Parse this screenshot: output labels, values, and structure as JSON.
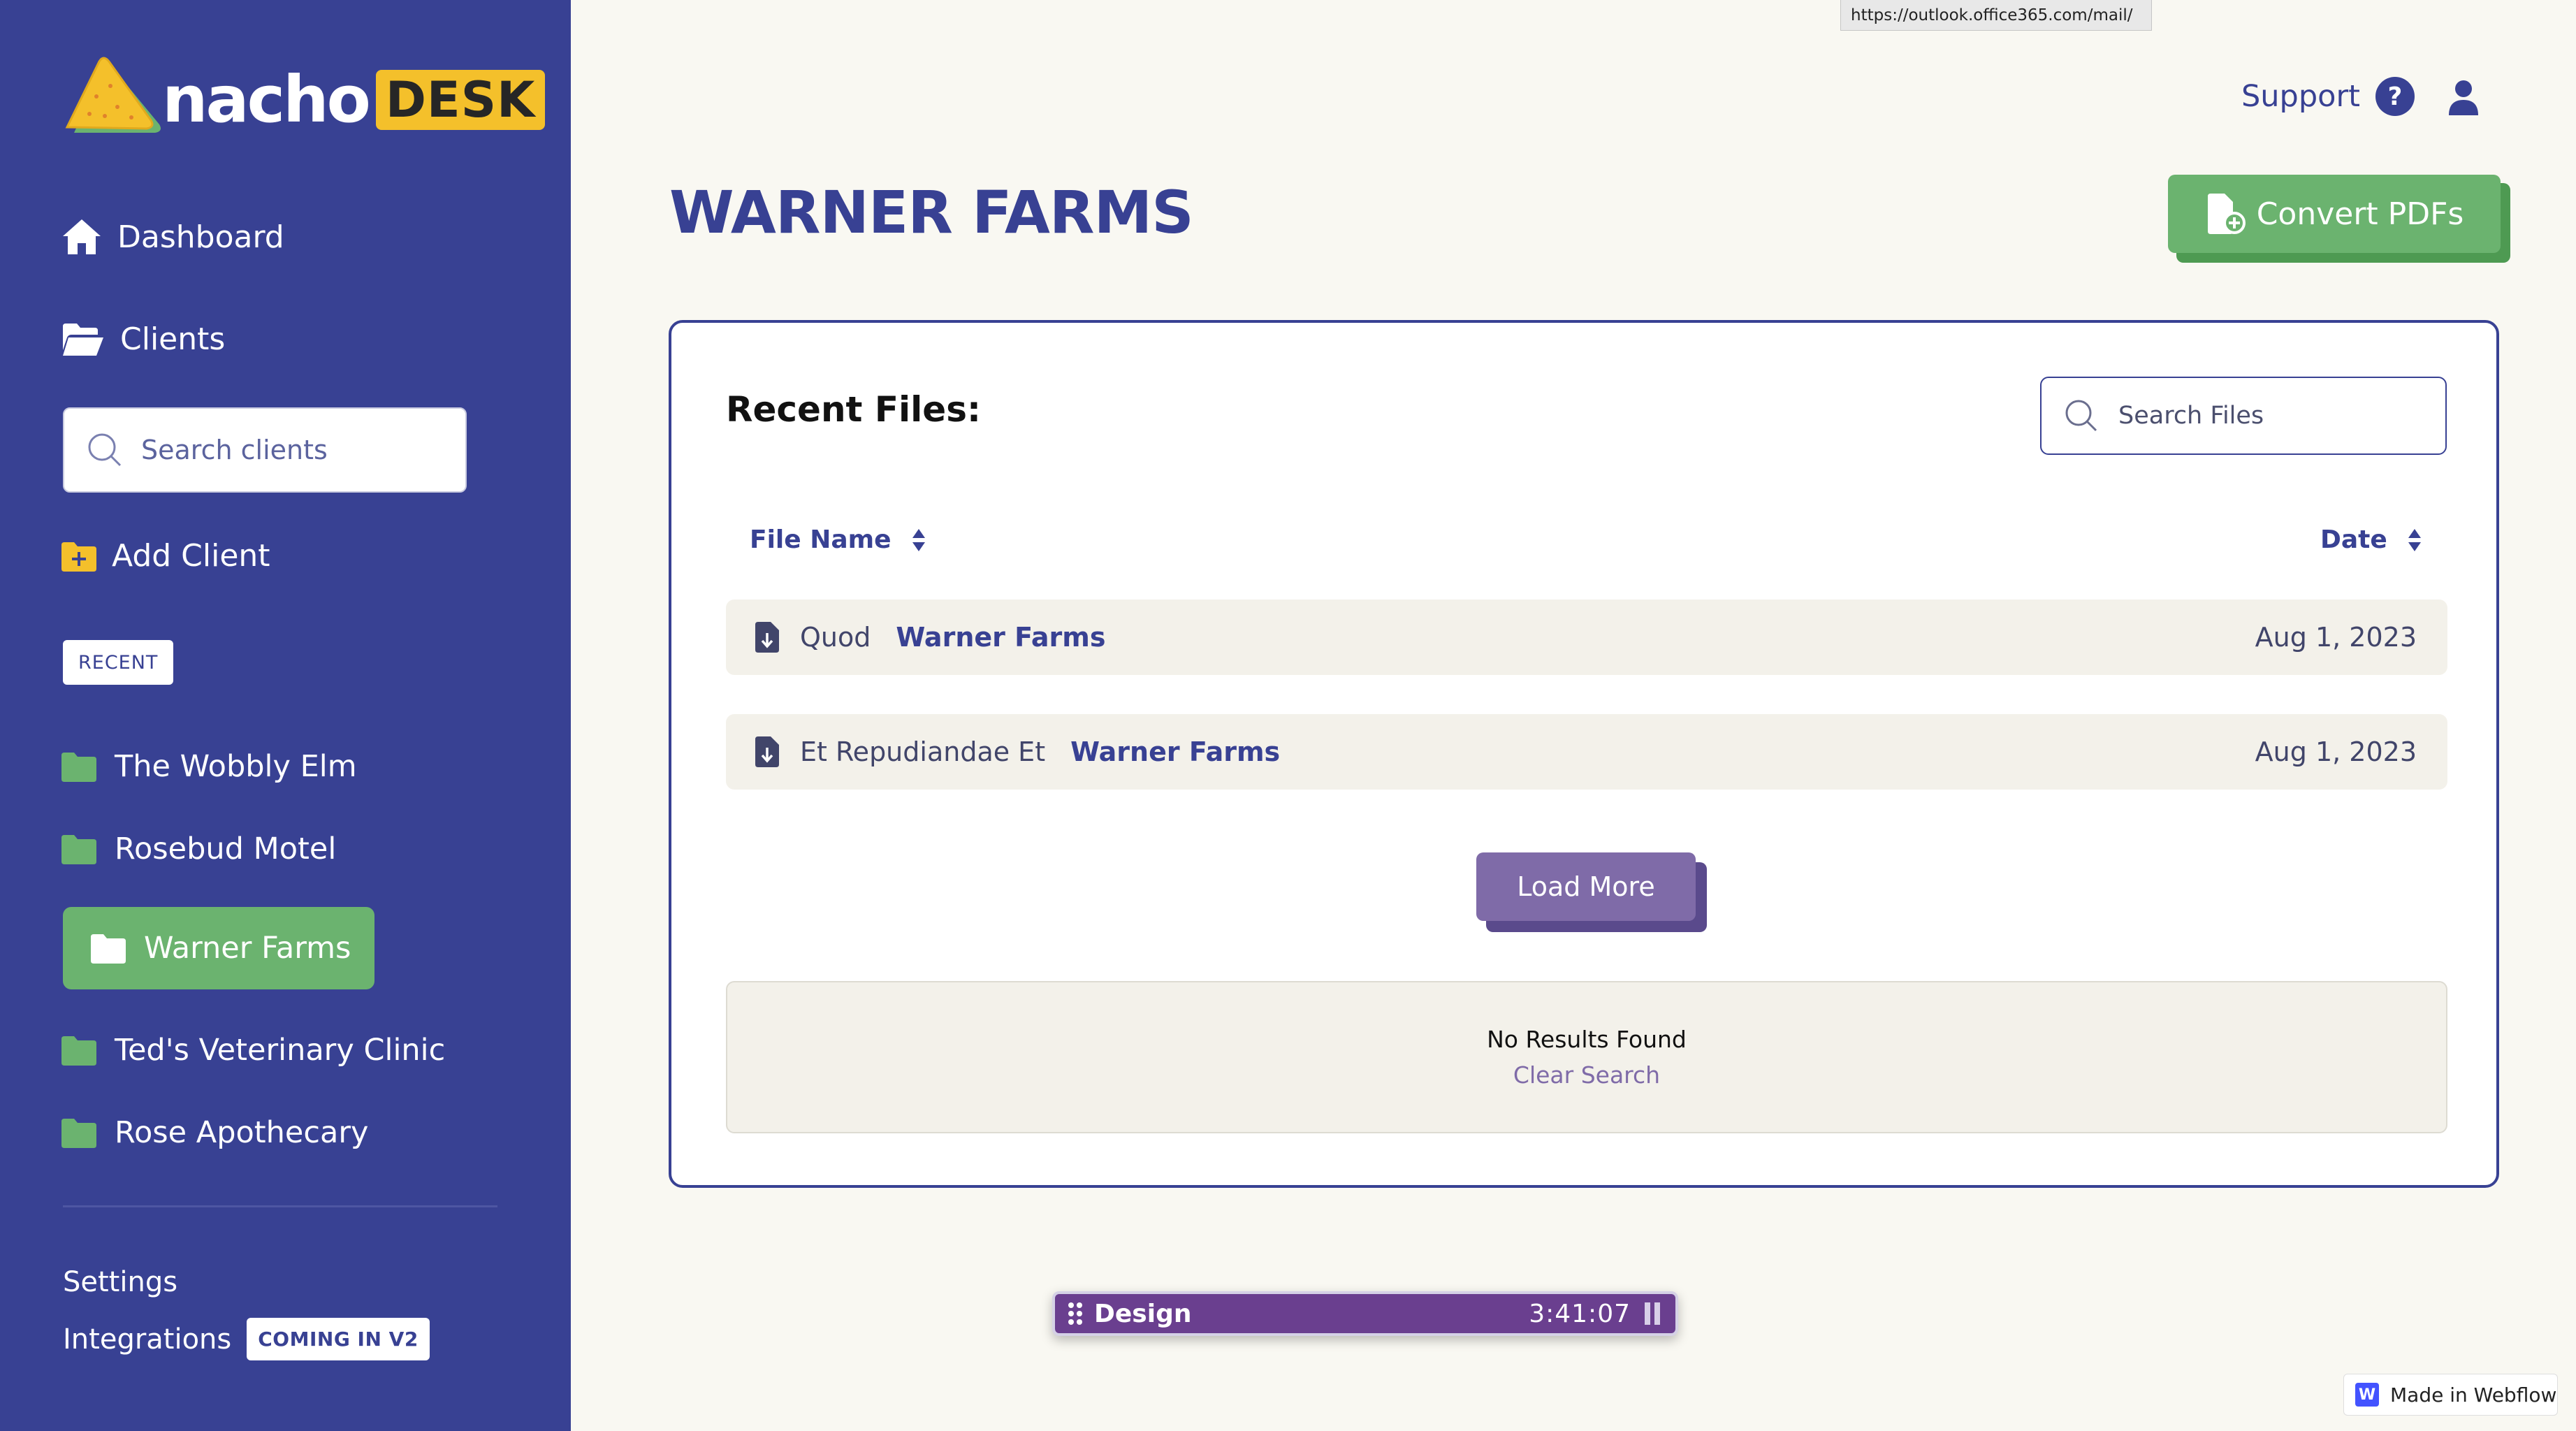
{
  "brand": {
    "word": "nacho",
    "badge": "DESK"
  },
  "url_tooltip": "https://outlook.office365.com/mail/",
  "sidebar": {
    "nav": [
      {
        "label": "Dashboard",
        "icon": "home-icon"
      },
      {
        "label": "Clients",
        "icon": "folder-open-icon"
      }
    ],
    "search_placeholder": "Search clients",
    "add_client_label": "Add Client",
    "recent_label": "RECENT",
    "clients": [
      {
        "label": "The Wobbly Elm",
        "active": false
      },
      {
        "label": "Rosebud Motel",
        "active": false
      },
      {
        "label": "Warner Farms",
        "active": true
      },
      {
        "label": "Ted's Veterinary Clinic",
        "active": false
      },
      {
        "label": "Rose Apothecary",
        "active": false
      }
    ],
    "settings_label": "Settings",
    "integrations_label": "Integrations",
    "integrations_badge": "COMING IN V2"
  },
  "header": {
    "support_label": "Support",
    "support_icon": "?"
  },
  "main": {
    "title": "WARNER FARMS",
    "convert_label": "Convert PDFs",
    "recent_files_title": "Recent Files:",
    "search_files_placeholder": "Search Files",
    "columns": {
      "file_name": "File Name",
      "date": "Date"
    },
    "files": [
      {
        "name": "Quod",
        "client": "Warner Farms",
        "date": "Aug 1, 2023"
      },
      {
        "name": "Et Repudiandae Et",
        "client": "Warner Farms",
        "date": "Aug 1, 2023"
      }
    ],
    "load_more_label": "Load More",
    "no_results": "No Results Found",
    "clear_search": "Clear Search"
  },
  "timer": {
    "task": "Design",
    "time": "3:41:07"
  },
  "webflow_badge": {
    "icon_letter": "W",
    "label": "Made in Webflow"
  },
  "colors": {
    "sidebar_bg": "#384193",
    "accent_green": "#6bb36f",
    "accent_purple": "#7f6ba8",
    "page_bg": "#f9f8f2",
    "logo_yellow": "#f4c02b"
  }
}
